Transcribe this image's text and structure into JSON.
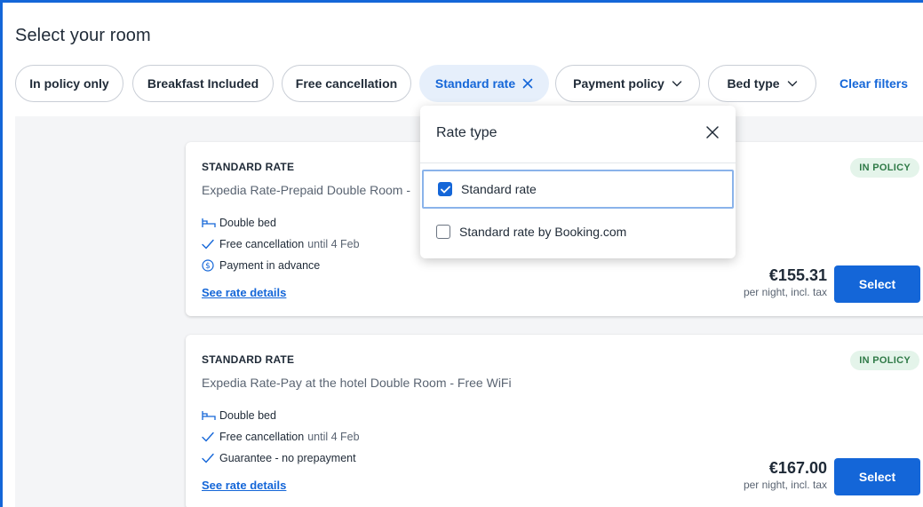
{
  "page": {
    "title": "Select your room"
  },
  "filters": {
    "chips": [
      {
        "label": "In policy only"
      },
      {
        "label": "Breakfast Included"
      },
      {
        "label": "Free cancellation"
      },
      {
        "label": "Standard rate"
      },
      {
        "label": "Payment policy"
      },
      {
        "label": "Bed type"
      }
    ],
    "clear_label": "Clear filters"
  },
  "dropdown": {
    "title": "Rate type",
    "options": [
      {
        "label": "Standard rate",
        "checked": true
      },
      {
        "label": "Standard rate by Booking.com",
        "checked": false
      }
    ]
  },
  "rooms": [
    {
      "rate_title": "STANDARD RATE",
      "name": "Expedia Rate-Prepaid Double Room -",
      "badge": "IN POLICY",
      "features": {
        "bed": "Double bed",
        "cancel": "Free cancellation",
        "cancel_note": "until 4 Feb",
        "payment": "Payment in advance"
      },
      "details_label": "See rate details",
      "price": "€155.31",
      "price_note": "per night, incl. tax",
      "select_label": "Select"
    },
    {
      "rate_title": "STANDARD RATE",
      "name": "Expedia Rate-Pay at the hotel Double Room - Free WiFi",
      "badge": "IN POLICY",
      "features": {
        "bed": "Double bed",
        "cancel": "Free cancellation",
        "cancel_note": "until 4 Feb",
        "payment": "Guarantee - no prepayment"
      },
      "details_label": "See rate details",
      "price": "€167.00",
      "price_note": "per night, incl. tax",
      "select_label": "Select"
    }
  ],
  "colors": {
    "accent": "#1466d8",
    "policy_badge_bg": "#e4f4ea",
    "policy_badge_text": "#2f7a47"
  }
}
